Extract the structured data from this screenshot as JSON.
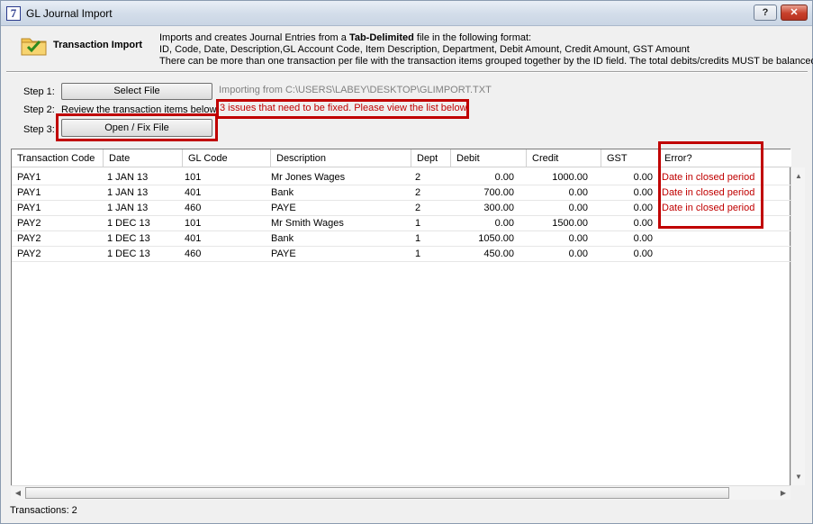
{
  "window": {
    "title": "GL Journal Import",
    "help_label": "?",
    "close_label": "✕"
  },
  "header": {
    "title": "Transaction Import",
    "desc_line1_pre": "Imports and creates Journal Entries from a ",
    "desc_line1_bold": "Tab-Delimited",
    "desc_line1_post": " file in the following format:",
    "desc_line2": "ID, Code, Date, Description,GL Account Code, Item Description, Department, Debit Amount, Credit Amount, GST Amount",
    "desc_line3": "There can be more than one transaction per file with the transaction items grouped together by the ID field. The total debits/credits MUST be balanced"
  },
  "steps": {
    "step1_label": "Step 1:",
    "select_file_label": "Select File",
    "import_path": "Importing from C:\\USERS\\LABEY\\DESKTOP\\GLIMPORT.TXT",
    "step2_label": "Step 2:",
    "step2_text": "Review the transaction items below",
    "issue_text": "3 issues that need to be fixed. Please view the list below",
    "step3_label": "Step 3:",
    "open_fix_label": "Open / Fix File"
  },
  "table": {
    "columns": [
      "Transaction Code",
      "Date",
      "GL Code",
      "Description",
      "Dept",
      "Debit",
      "Credit",
      "GST",
      "Error?"
    ],
    "rows": [
      {
        "code": "PAY1",
        "date": "1 JAN 13",
        "gl": "101",
        "desc": "Mr Jones Wages",
        "dept": "2",
        "debit": "0.00",
        "credit": "1000.00",
        "gst": "0.00",
        "error": "Date in closed period"
      },
      {
        "code": "PAY1",
        "date": "1 JAN 13",
        "gl": "401",
        "desc": "Bank",
        "dept": "2",
        "debit": "700.00",
        "credit": "0.00",
        "gst": "0.00",
        "error": "Date in closed period"
      },
      {
        "code": "PAY1",
        "date": "1 JAN 13",
        "gl": "460",
        "desc": "PAYE",
        "dept": "2",
        "debit": "300.00",
        "credit": "0.00",
        "gst": "0.00",
        "error": "Date in closed period"
      },
      {
        "code": "PAY2",
        "date": "1 DEC 13",
        "gl": "101",
        "desc": "Mr Smith Wages",
        "dept": "1",
        "debit": "0.00",
        "credit": "1500.00",
        "gst": "0.00",
        "error": ""
      },
      {
        "code": "PAY2",
        "date": "1 DEC 13",
        "gl": "401",
        "desc": "Bank",
        "dept": "1",
        "debit": "1050.00",
        "credit": "0.00",
        "gst": "0.00",
        "error": ""
      },
      {
        "code": "PAY2",
        "date": "1 DEC 13",
        "gl": "460",
        "desc": "PAYE",
        "dept": "1",
        "debit": "450.00",
        "credit": "0.00",
        "gst": "0.00",
        "error": ""
      }
    ]
  },
  "status": {
    "text": "Transactions: 2"
  },
  "colors": {
    "error": "#c00000",
    "highlight_box": "#c00000"
  },
  "icons": {
    "app": "seven-app-icon",
    "header": "folder-check-icon"
  }
}
